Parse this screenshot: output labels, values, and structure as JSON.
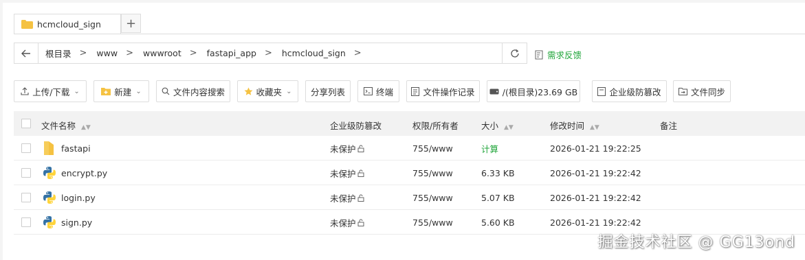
{
  "tab": {
    "label": "hcmcloud_sign",
    "add": "+"
  },
  "path": {
    "crumbs": [
      "根目录",
      "www",
      "wwwroot",
      "fastapi_app",
      "hcmcloud_sign"
    ],
    "separator": ">"
  },
  "feedback": {
    "label": "需求反馈"
  },
  "toolbar": {
    "upload_download": "上传/下载",
    "new": "新建",
    "content_search": "文件内容搜索",
    "favorites": "收藏夹",
    "share_list": "分享列表",
    "terminal": "终端",
    "file_op_log": "文件操作记录",
    "disk": "/(根目录)23.69 GB",
    "tamper_proof": "企业级防篡改",
    "file_sync": "文件同步"
  },
  "table": {
    "headers": {
      "name": "文件名称",
      "tamper": "企业级防篡改",
      "perm": "权限/所有者",
      "size": "大小",
      "mtime": "修改时间",
      "note": "备注"
    },
    "rows": [
      {
        "icon": "folder-icon",
        "name": "fastapi",
        "tamper": "未保护",
        "perm": "755/www",
        "size": "计算",
        "mtime": "2026-01-21 19:22:25",
        "size_link": true
      },
      {
        "icon": "python-icon",
        "name": "encrypt.py",
        "tamper": "未保护",
        "perm": "755/www",
        "size": "6.33 KB",
        "mtime": "2026-01-21 19:22:42",
        "size_link": false
      },
      {
        "icon": "python-icon",
        "name": "login.py",
        "tamper": "未保护",
        "perm": "755/www",
        "size": "5.07 KB",
        "mtime": "2026-01-21 19:22:42",
        "size_link": false
      },
      {
        "icon": "python-icon",
        "name": "sign.py",
        "tamper": "未保护",
        "perm": "755/www",
        "size": "5.60 KB",
        "mtime": "2026-01-21 19:22:42",
        "size_link": false
      }
    ]
  },
  "watermark": "掘金技术社区 @ GG13ond",
  "colors": {
    "accent": "#20a53a",
    "folder": "#f5c242",
    "python_blue": "#3572a5",
    "python_yellow": "#ffd43b"
  }
}
